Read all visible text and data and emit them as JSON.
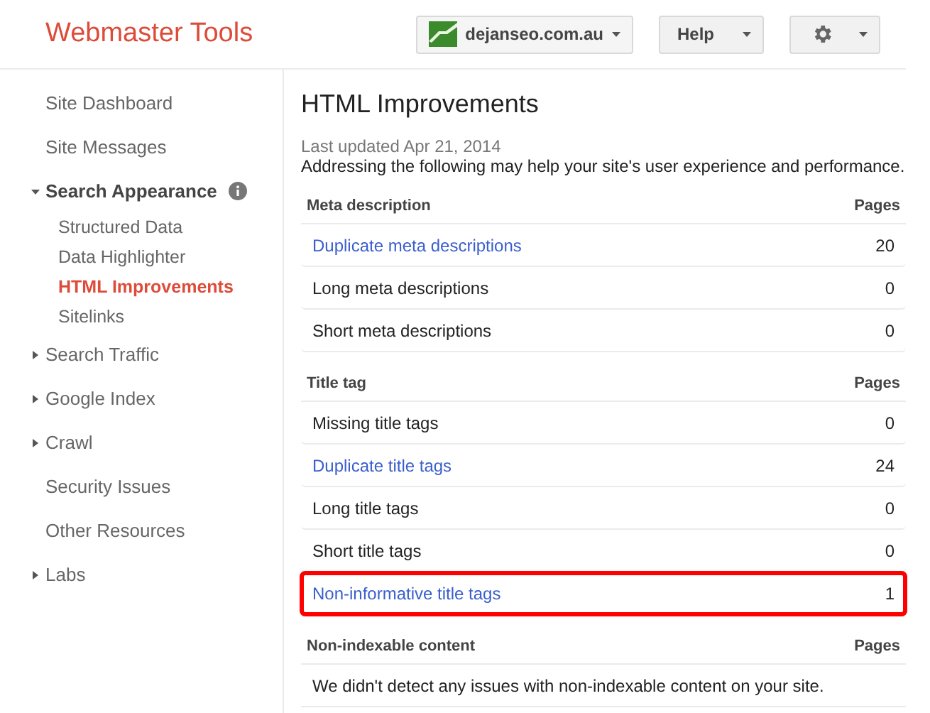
{
  "header": {
    "logo": "Webmaster Tools",
    "site_selector": "dejanseo.com.au",
    "help_button": "Help"
  },
  "sidebar": {
    "items": [
      {
        "kind": "link",
        "label": "Site Dashboard"
      },
      {
        "kind": "link",
        "label": "Site Messages"
      },
      {
        "kind": "section",
        "label": "Search Appearance",
        "expanded": true,
        "info": true,
        "children": [
          {
            "label": "Structured Data",
            "selected": false
          },
          {
            "label": "Data Highlighter",
            "selected": false
          },
          {
            "label": "HTML Improvements",
            "selected": true
          },
          {
            "label": "Sitelinks",
            "selected": false
          }
        ]
      },
      {
        "kind": "section",
        "label": "Search Traffic",
        "expanded": false
      },
      {
        "kind": "section",
        "label": "Google Index",
        "expanded": false
      },
      {
        "kind": "section",
        "label": "Crawl",
        "expanded": false
      },
      {
        "kind": "link",
        "label": "Security Issues"
      },
      {
        "kind": "link",
        "label": "Other Resources"
      },
      {
        "kind": "section",
        "label": "Labs",
        "expanded": false
      }
    ]
  },
  "main": {
    "title": "HTML Improvements",
    "last_updated": "Last updated Apr 21, 2014",
    "intro": "Addressing the following may help your site's user experience and performance.",
    "sections": [
      {
        "heading": "Meta description",
        "column": "Pages",
        "rows": [
          {
            "label": "Duplicate meta descriptions",
            "count": "20",
            "link": true,
            "highlighted": false
          },
          {
            "label": "Long meta descriptions",
            "count": "0",
            "link": false,
            "highlighted": false
          },
          {
            "label": "Short meta descriptions",
            "count": "0",
            "link": false,
            "highlighted": false
          }
        ]
      },
      {
        "heading": "Title tag",
        "column": "Pages",
        "rows": [
          {
            "label": "Missing title tags",
            "count": "0",
            "link": false,
            "highlighted": false
          },
          {
            "label": "Duplicate title tags",
            "count": "24",
            "link": true,
            "highlighted": false
          },
          {
            "label": "Long title tags",
            "count": "0",
            "link": false,
            "highlighted": false
          },
          {
            "label": "Short title tags",
            "count": "0",
            "link": false,
            "highlighted": false
          },
          {
            "label": "Non-informative title tags",
            "count": "1",
            "link": true,
            "highlighted": true
          }
        ]
      },
      {
        "heading": "Non-indexable content",
        "column": "Pages",
        "message": "We didn't detect any issues with non-indexable content on your site."
      }
    ]
  }
}
